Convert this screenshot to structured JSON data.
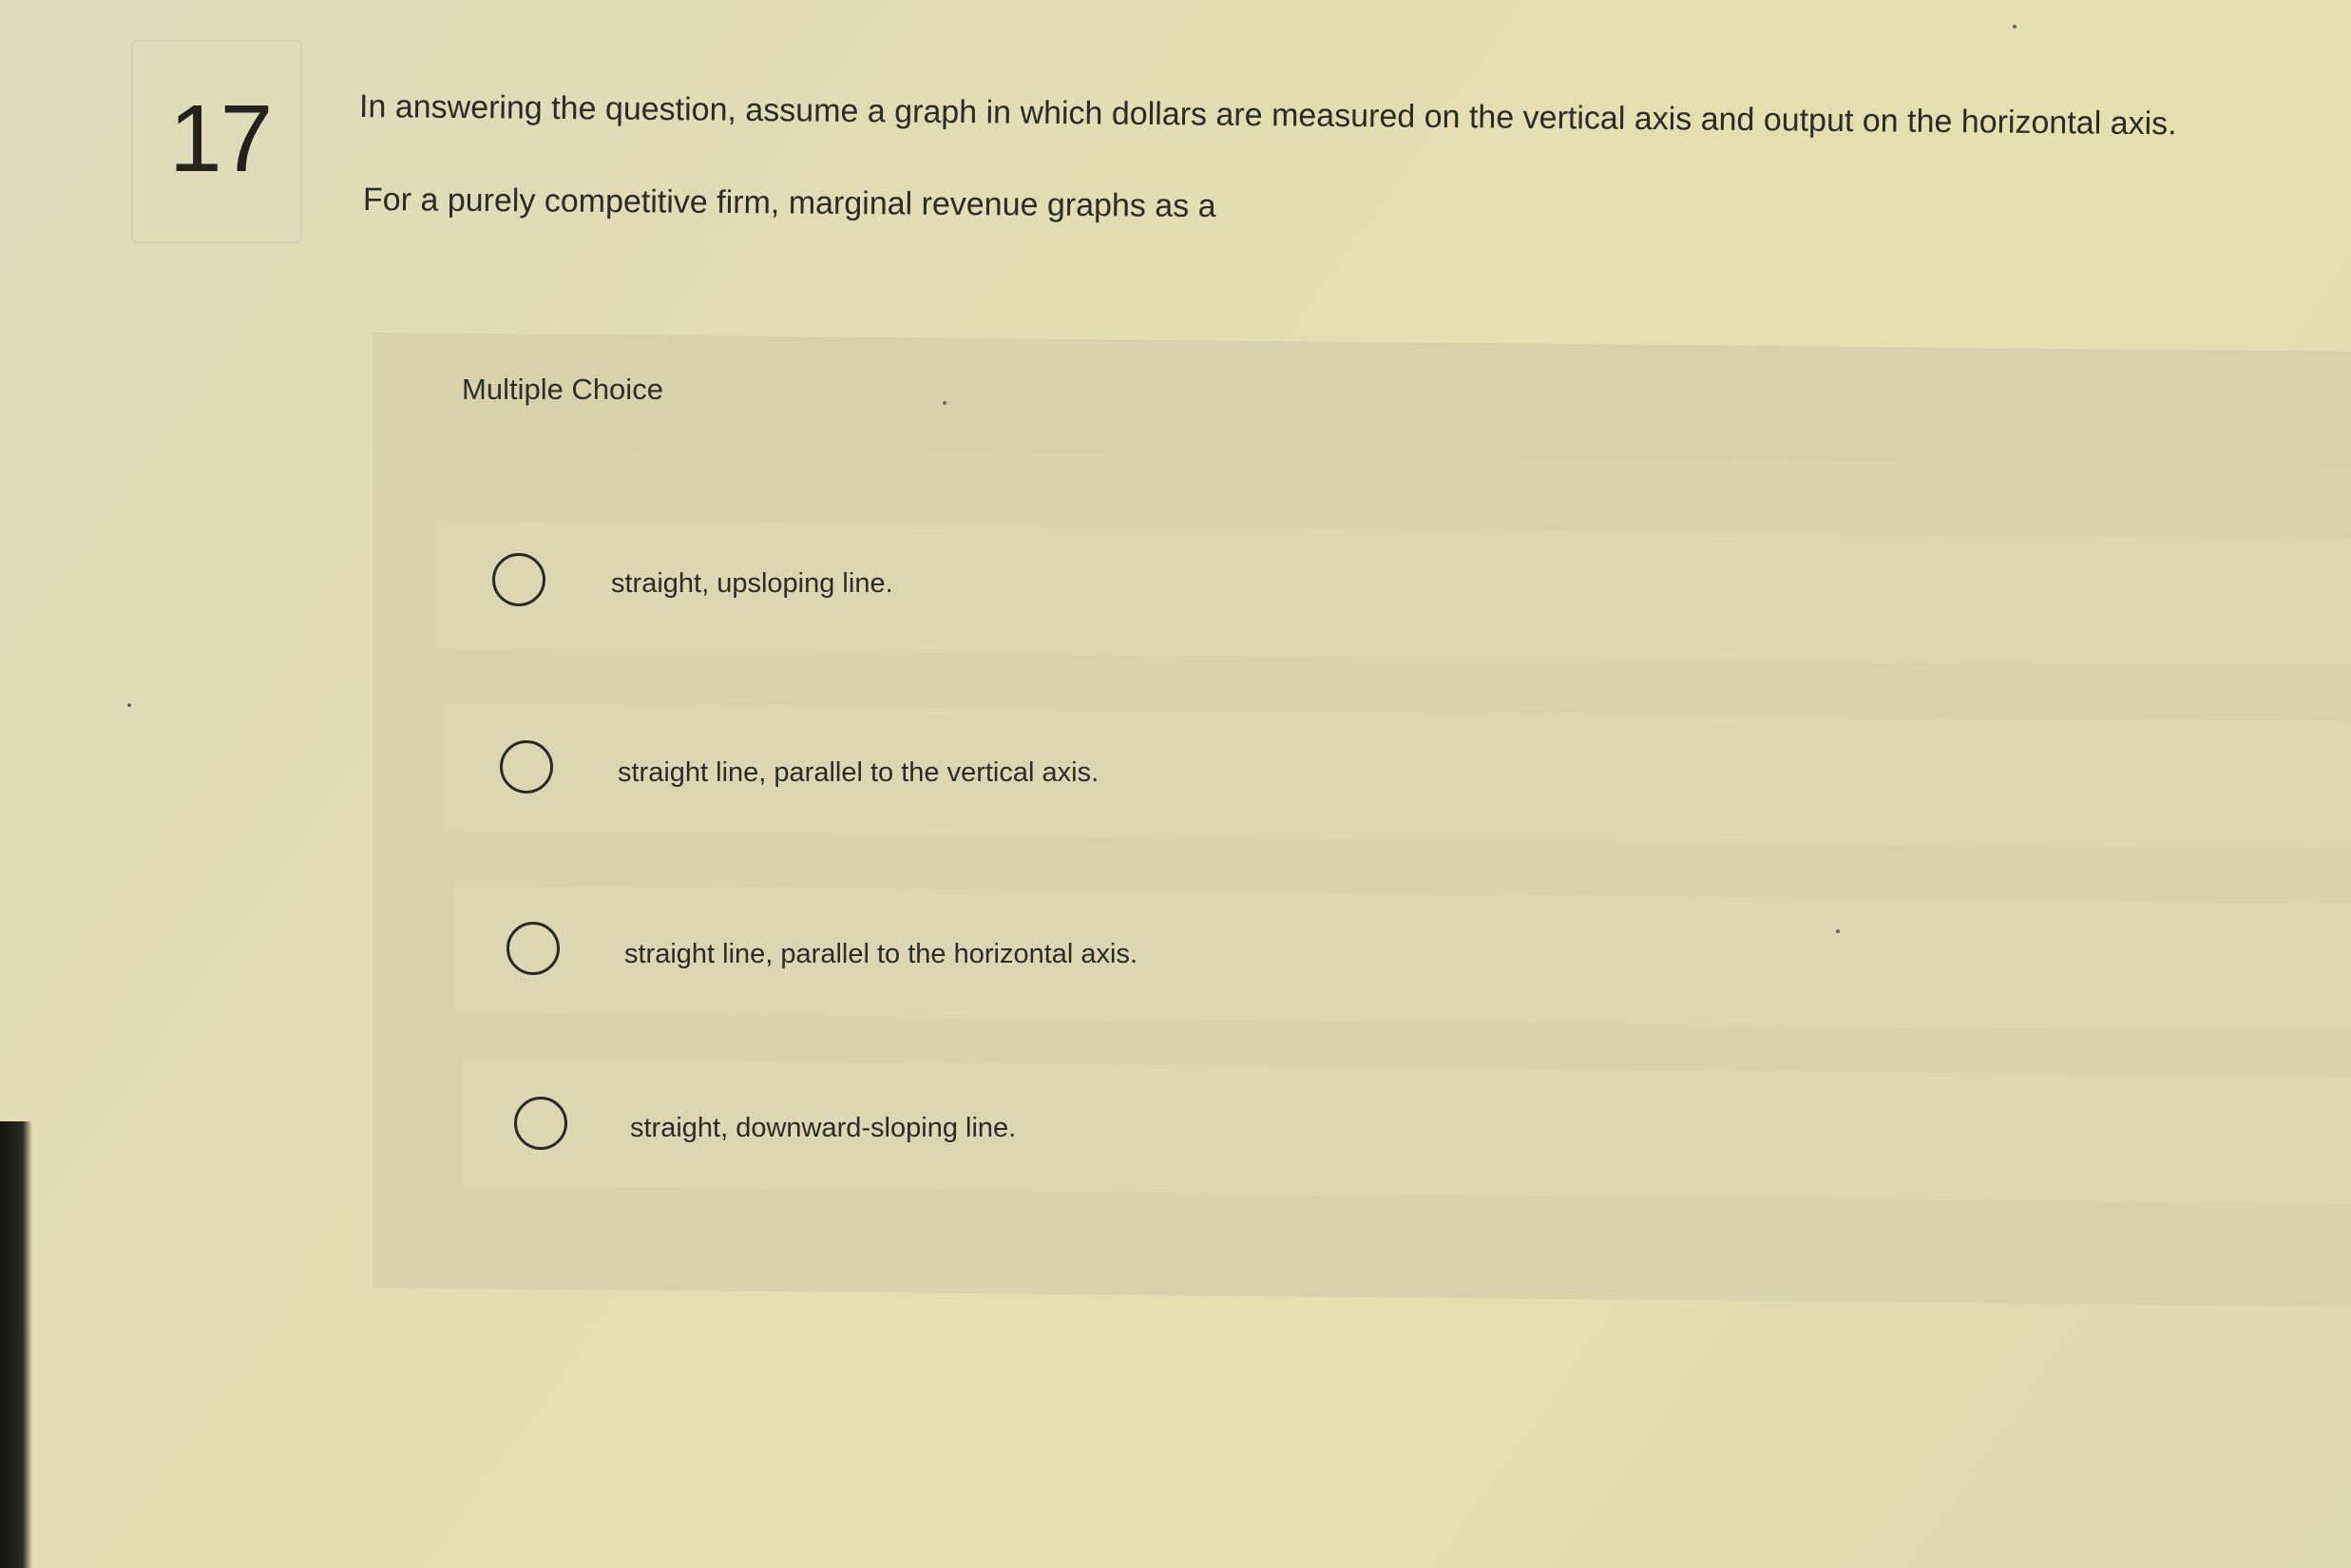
{
  "question": {
    "number": "17",
    "prompt": "In answering the question, assume a graph in which dollars are measured on the vertical axis and output on the horizontal axis.",
    "stem": "For a purely competitive firm, marginal revenue graphs as a"
  },
  "multiple_choice": {
    "title": "Multiple Choice",
    "options": [
      {
        "label": "straight, upsloping line.",
        "selected": false
      },
      {
        "label": "straight line, parallel to the vertical axis.",
        "selected": false
      },
      {
        "label": "straight line, parallel to the horizontal axis.",
        "selected": false
      },
      {
        "label": "straight, downward-sloping line.",
        "selected": false
      }
    ]
  },
  "colors": {
    "background": "#e3ddb2",
    "panel": "#d9d4ae",
    "text": "#2c2b25"
  }
}
